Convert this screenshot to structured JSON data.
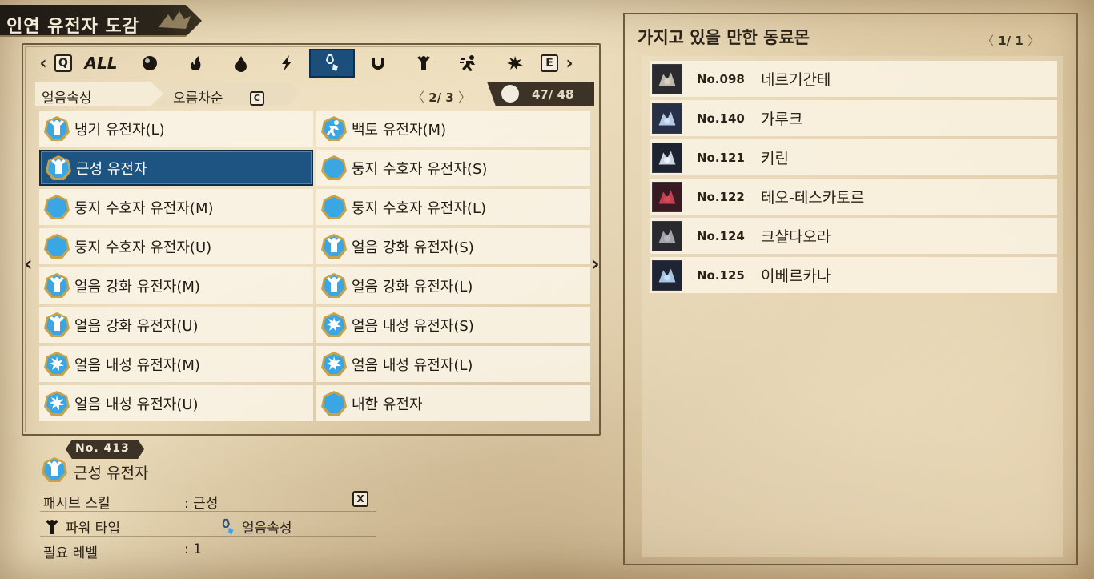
{
  "header": {
    "title": "인연 유전자 도감"
  },
  "tabs": {
    "prev_key": "Q",
    "next_key": "E",
    "items": [
      {
        "label": "ALL",
        "icon": "all-text"
      },
      {
        "label": "",
        "icon": "non-element-icon"
      },
      {
        "label": "",
        "icon": "fire-icon"
      },
      {
        "label": "",
        "icon": "water-icon"
      },
      {
        "label": "",
        "icon": "thunder-icon"
      },
      {
        "label": "",
        "icon": "ice-icon",
        "active": true
      },
      {
        "label": "",
        "icon": "dragon-icon"
      },
      {
        "label": "",
        "icon": "power-type-icon"
      },
      {
        "label": "",
        "icon": "speed-type-icon"
      },
      {
        "label": "",
        "icon": "technical-type-icon"
      }
    ]
  },
  "subbar": {
    "sort_attribute": "얼음속성",
    "sort_order": "오름차순",
    "sort_key": "C",
    "page_current": "2/",
    "page_total": "3",
    "collected": "47/",
    "total": "48"
  },
  "genes": [
    {
      "name": "냉기 유전자(L)",
      "icon": "power-gene-icon"
    },
    {
      "name": "백토 유전자(M)",
      "icon": "speed-gene-icon"
    },
    {
      "name": "근성 유전자",
      "icon": "power-gene-icon",
      "selected": true
    },
    {
      "name": "둥지 수호자 유전자(S)",
      "icon": "plain-gene-icon"
    },
    {
      "name": "둥지 수호자 유전자(M)",
      "icon": "plain-gene-icon"
    },
    {
      "name": "둥지 수호자 유전자(L)",
      "icon": "plain-gene-icon"
    },
    {
      "name": "둥지 수호자 유전자(U)",
      "icon": "plain-gene-icon"
    },
    {
      "name": "얼음 강화 유전자(S)",
      "icon": "power-gene-icon"
    },
    {
      "name": "얼음 강화 유전자(M)",
      "icon": "power-gene-icon"
    },
    {
      "name": "얼음 강화 유전자(L)",
      "icon": "power-gene-icon"
    },
    {
      "name": "얼음 강화 유전자(U)",
      "icon": "power-gene-icon"
    },
    {
      "name": "얼음 내성 유전자(S)",
      "icon": "technical-gene-icon"
    },
    {
      "name": "얼음 내성 유전자(M)",
      "icon": "technical-gene-icon"
    },
    {
      "name": "얼음 내성 유전자(L)",
      "icon": "technical-gene-icon"
    },
    {
      "name": "얼음 내성 유전자(U)",
      "icon": "technical-gene-icon"
    },
    {
      "name": "내한 유전자",
      "icon": "plain-gene-icon"
    }
  ],
  "nav": {
    "prev": "‹",
    "next": "›"
  },
  "detail": {
    "number_label": "No.",
    "number": "413",
    "name": "근성 유전자",
    "passive_label": "패시브 스킬",
    "passive_value": ": 근성",
    "passive_key": "X",
    "type_label": "파워 타입",
    "element_label": "얼음속성",
    "level_label": "필요 레벨",
    "level_value": ": 1"
  },
  "monsters_panel": {
    "title": "가지고 있을 만한 동료몬",
    "page_current": "1/",
    "page_total": "1",
    "items": [
      {
        "no": "No.098",
        "name": "네르기간테",
        "icon": "nergigante-icon"
      },
      {
        "no": "No.140",
        "name": "가루크",
        "icon": "garuk-icon"
      },
      {
        "no": "No.121",
        "name": "키린",
        "icon": "kirin-icon"
      },
      {
        "no": "No.122",
        "name": "테오-테스카토르",
        "icon": "teostra-icon"
      },
      {
        "no": "No.124",
        "name": "크샬다오라",
        "icon": "kushala-daora-icon"
      },
      {
        "no": "No.125",
        "name": "이베르카나",
        "icon": "velkhana-icon"
      }
    ]
  },
  "colors": {
    "accent": "#1d5482",
    "gene_blue": "#3aa7e4",
    "gene_gold": "#c8a24a"
  }
}
